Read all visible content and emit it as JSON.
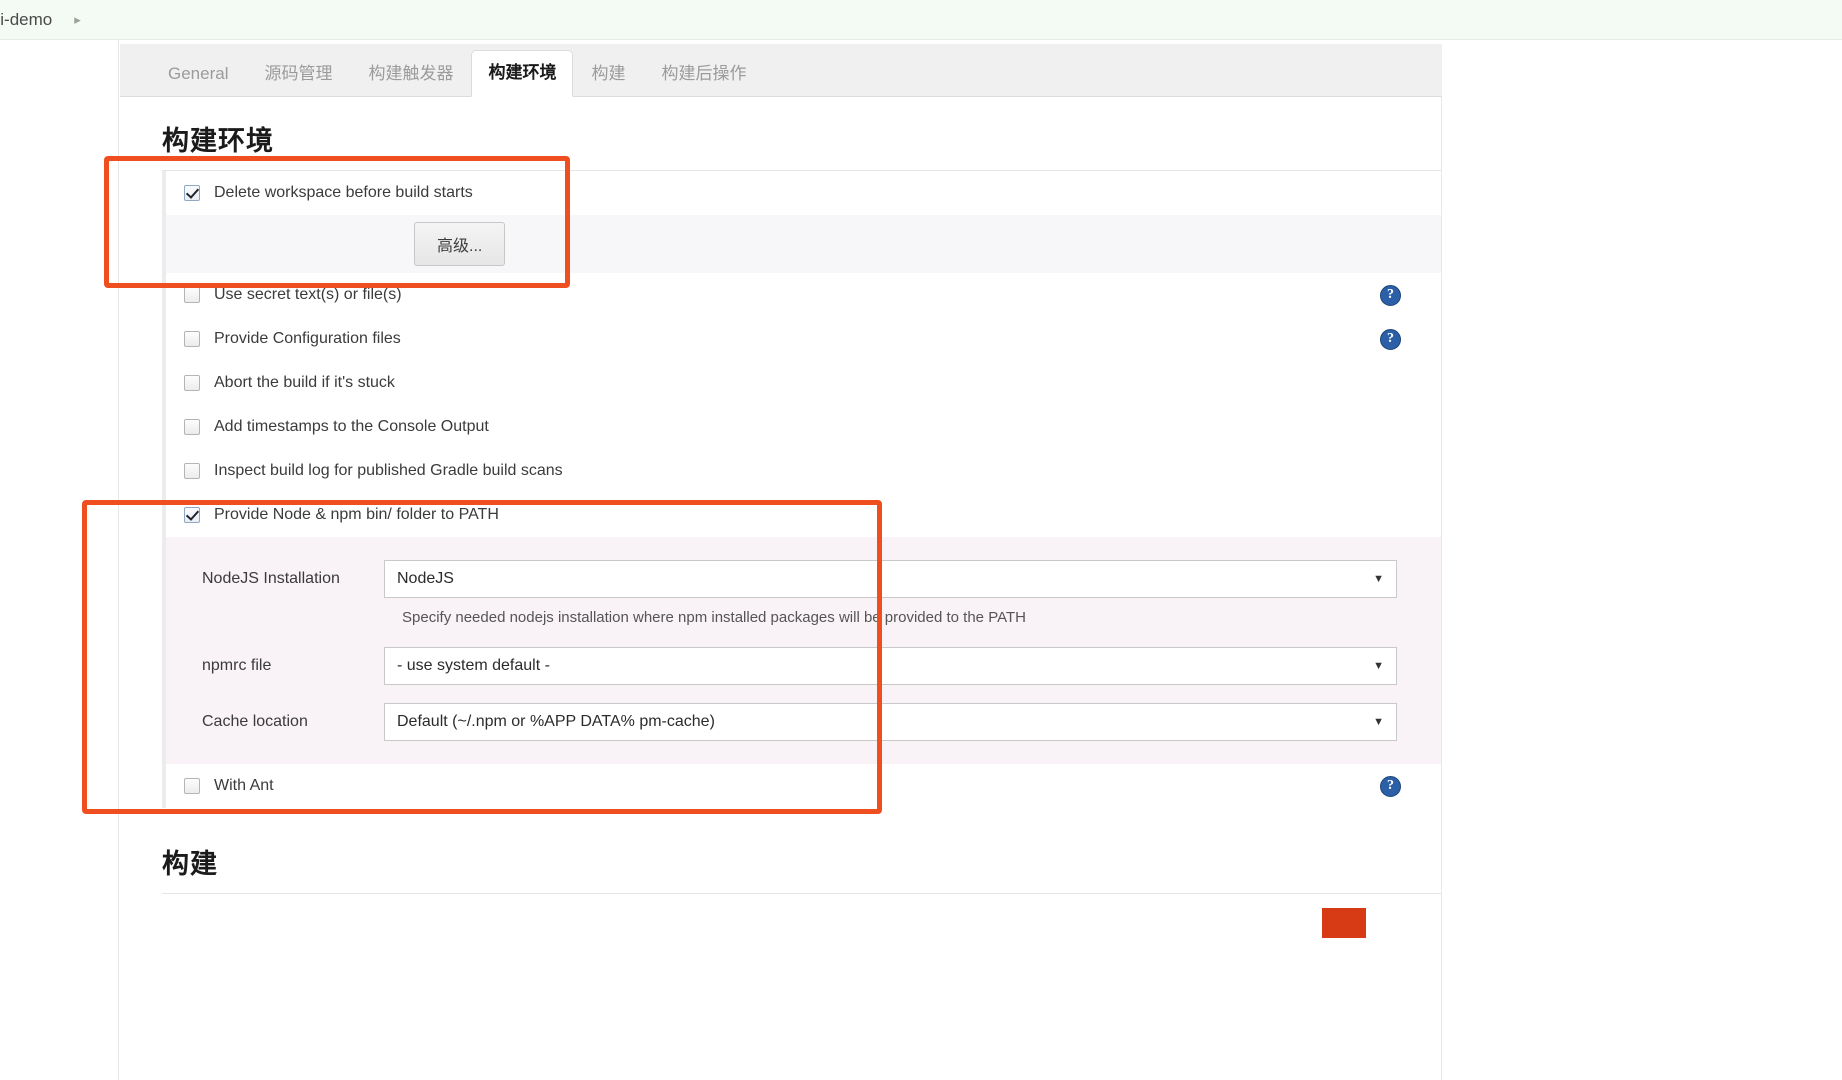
{
  "breadcrumb": {
    "item": "cli-demo",
    "separator": "▸"
  },
  "tabs": [
    {
      "label": "General",
      "active": false
    },
    {
      "label": "源码管理",
      "active": false
    },
    {
      "label": "构建触发器",
      "active": false
    },
    {
      "label": "构建环境",
      "active": true
    },
    {
      "label": "构建",
      "active": false
    },
    {
      "label": "构建后操作",
      "active": false
    }
  ],
  "build_env": {
    "title": "构建环境",
    "delete_workspace": {
      "label": "Delete workspace before build starts",
      "checked": true
    },
    "advanced_button": "高级...",
    "checkboxes": [
      {
        "label": "Use secret text(s) or file(s)",
        "checked": false,
        "help": true
      },
      {
        "label": "Provide Configuration files",
        "checked": false,
        "help": true
      },
      {
        "label": "Abort the build if it's stuck",
        "checked": false,
        "help": false
      },
      {
        "label": "Add timestamps to the Console Output",
        "checked": false,
        "help": false
      },
      {
        "label": "Inspect build log for published Gradle build scans",
        "checked": false,
        "help": false
      }
    ],
    "nodejs": {
      "label": "Provide Node & npm bin/ folder to PATH",
      "checked": true,
      "installation": {
        "label": "NodeJS Installation",
        "value": "NodeJS",
        "hint": "Specify needed nodejs installation where npm installed packages will be provided to the PATH"
      },
      "npmrc": {
        "label": "npmrc file",
        "value": "- use system default -"
      },
      "cache": {
        "label": "Cache location",
        "value": "Default (~/.npm or %APP  DATA% pm-cache)"
      }
    },
    "with_ant": {
      "label": "With Ant",
      "checked": false,
      "help": true
    }
  },
  "build_section": {
    "title": "构建"
  },
  "icons": {
    "help": "?",
    "caret_down": "▼"
  },
  "colors": {
    "annotation": "#ef4f1f",
    "help_icon": "#2b5fa8",
    "active_tab_text": "#1a1a1a",
    "form_row_bg": "#f9f2f6"
  }
}
